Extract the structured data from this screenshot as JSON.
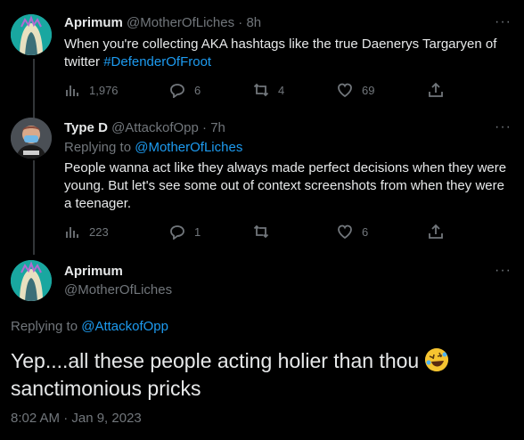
{
  "tweets": [
    {
      "name": "Aprimum",
      "handle": "@MotherOfLiches",
      "time": "· 8h",
      "text_prefix": "When you're collecting AKA hashtags like the true Daenerys Targaryen of twitter ",
      "hashtag": "#DefenderOfFroot",
      "views": "1,976",
      "replies": "6",
      "retweets": "4",
      "likes": "69"
    },
    {
      "name": "Type D",
      "handle": "@AttackofOpp",
      "time": "· 7h",
      "replying_prefix": "Replying to ",
      "replying_handle": "@MotherOfLiches",
      "text": "People wanna act like they always made perfect decisions when they were young. But let's see some out of context screenshots from when they were a teenager.",
      "views": "223",
      "replies": "1",
      "retweets": "",
      "likes": "6"
    }
  ],
  "focus": {
    "name": "Aprimum",
    "handle": "@MotherOfLiches",
    "replying_prefix": "Replying to ",
    "replying_handle": "@AttackofOpp",
    "text": "Yep....all these people acting holier than thou",
    "text_after_emoji": "sanctimonious pricks",
    "emoji": "rolling-on-floor-laughing-emoji",
    "timestamp": "8:02 AM · Jan 9, 2023"
  },
  "more_label": "···",
  "colors": {
    "link": "#1d9bf0",
    "muted": "#71767b",
    "background": "#000000"
  }
}
